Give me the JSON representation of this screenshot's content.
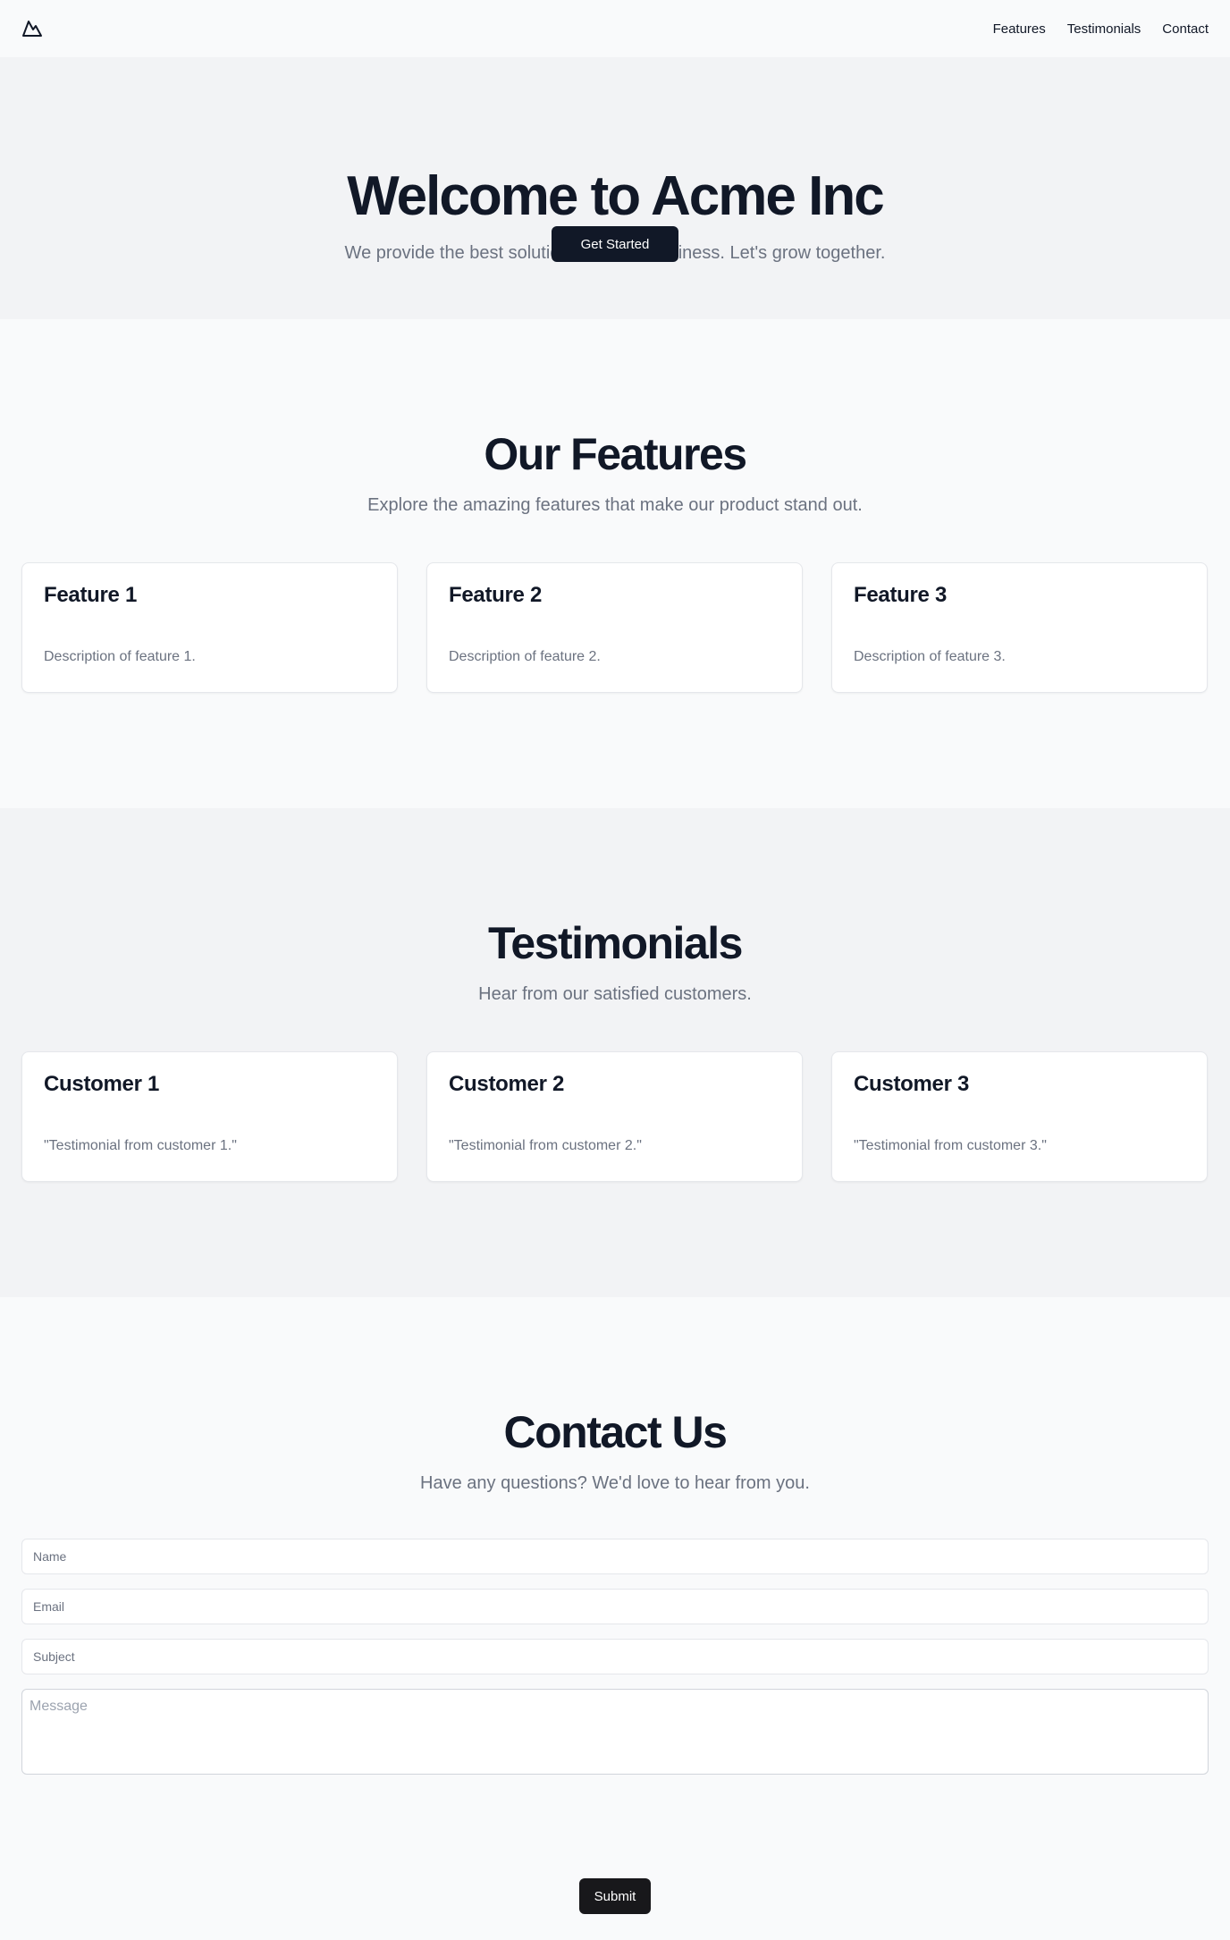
{
  "header": {
    "logo_icon": "mountain-icon",
    "nav": [
      {
        "label": "Features"
      },
      {
        "label": "Testimonials"
      },
      {
        "label": "Contact"
      }
    ]
  },
  "hero": {
    "title": "Welcome to Acme Inc",
    "subtitle": "We provide the best solutions for your business. Let's grow together.",
    "cta_label": "Get Started"
  },
  "features": {
    "title": "Our Features",
    "subtitle": "Explore the amazing features that make our product stand out.",
    "cards": [
      {
        "title": "Feature 1",
        "text": "Description of feature 1."
      },
      {
        "title": "Feature 2",
        "text": "Description of feature 2."
      },
      {
        "title": "Feature 3",
        "text": "Description of feature 3."
      }
    ]
  },
  "testimonials": {
    "title": "Testimonials",
    "subtitle": "Hear from our satisfied customers.",
    "cards": [
      {
        "title": "Customer 1",
        "text": "\"Testimonial from customer 1.\""
      },
      {
        "title": "Customer 2",
        "text": "\"Testimonial from customer 2.\""
      },
      {
        "title": "Customer 3",
        "text": "\"Testimonial from customer 3.\""
      }
    ]
  },
  "contact": {
    "title": "Contact Us",
    "subtitle": "Have any questions? We'd love to hear from you.",
    "name_placeholder": "Name",
    "email_placeholder": "Email",
    "subject_placeholder": "Subject",
    "message_placeholder": "Message",
    "submit_label": "Submit"
  },
  "colors": {
    "primary_dark": "#111827",
    "muted_text": "#6b7280",
    "page_bg": "#f9fafb",
    "alt_section_bg": "#f2f3f5"
  }
}
